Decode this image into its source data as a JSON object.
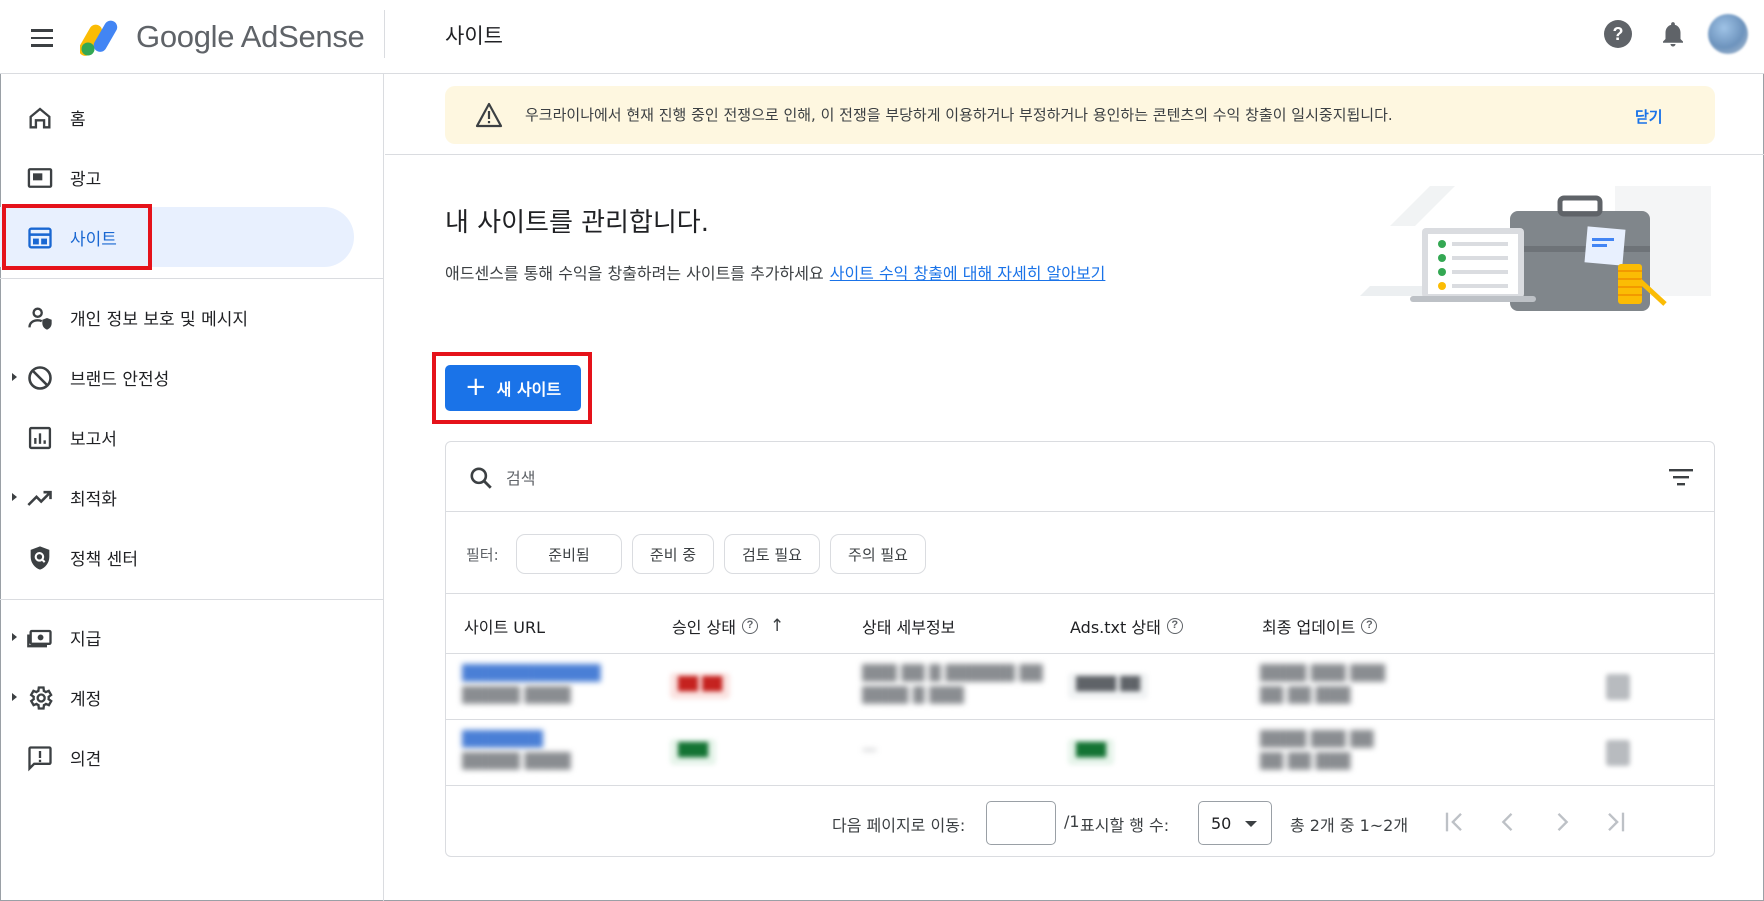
{
  "app": {
    "logo_text": "Google AdSense",
    "page_title": "사이트"
  },
  "sidebar": {
    "items": [
      {
        "label": "홈",
        "icon": "home-icon"
      },
      {
        "label": "광고",
        "icon": "ads-icon"
      },
      {
        "label": "사이트",
        "icon": "sites-icon"
      },
      {
        "label": "개인 정보 보호 및 메시지",
        "icon": "privacy-messaging-icon"
      },
      {
        "label": "브랜드 안전성",
        "icon": "block-icon"
      },
      {
        "label": "보고서",
        "icon": "reports-icon"
      },
      {
        "label": "최적화",
        "icon": "trending-up-icon"
      },
      {
        "label": "정책 센터",
        "icon": "policy-shield-icon"
      },
      {
        "label": "지급",
        "icon": "payments-icon"
      },
      {
        "label": "계정",
        "icon": "gear-icon"
      },
      {
        "label": "의견",
        "icon": "feedback-icon"
      }
    ],
    "active_item": "사이트"
  },
  "banner": {
    "text": "우크라이나에서 현재 진행 중인 전쟁으로 인해, 이 전쟁을 부당하게 이용하거나 부정하거나 용인하는 콘텐츠의 수익 창출이 일시중지됩니다.",
    "close_label": "닫기"
  },
  "hero": {
    "title": "내 사이트를 관리합니다.",
    "subtitle": "애드센스를 통해 수익을 창출하려는 사이트를 추가하세요",
    "learn_more_link": "사이트 수익 창출에 대해 자세히 알아보기"
  },
  "actions": {
    "new_site_label": "새 사이트"
  },
  "search": {
    "placeholder": "검색"
  },
  "filters": {
    "label": "필터:",
    "chips": [
      "준비됨",
      "준비 중",
      "검토 필요",
      "주의 필요"
    ]
  },
  "table": {
    "columns": [
      "사이트 URL",
      "승인 상태",
      "상태 세부정보",
      "Ads.txt 상태",
      "최종 업데이트"
    ],
    "rows": [
      {
        "url": "████████████",
        "url_sub": "█████ ████",
        "approval": "██ ██",
        "details_1": "███ ██ █ ██████ ██",
        "details_2": "████ █ ███",
        "ads_txt": "████ ██",
        "updated_1": "████ ███ ███",
        "updated_2": "██ ██ ███"
      },
      {
        "url": "███████",
        "url_sub": "█████ ████",
        "approval": "███",
        "details_1": "—",
        "details_2": "",
        "ads_txt": "███",
        "updated_1": "████ ███ ██",
        "updated_2": "██ ██ ███"
      }
    ]
  },
  "pagination": {
    "goto_label": "다음 페이지로 이동:",
    "page_value": "",
    "total_pages": "/1",
    "rows_per_page_label": "표시할 행 수:",
    "rows_per_page_value": "50",
    "range_text": "총 2개 중 1~2개"
  },
  "colors": {
    "accent": "#1a73e8",
    "active_nav_bg": "#e8f0fe",
    "banner_bg": "#fef7e0",
    "highlight_box": "#e5121a"
  }
}
